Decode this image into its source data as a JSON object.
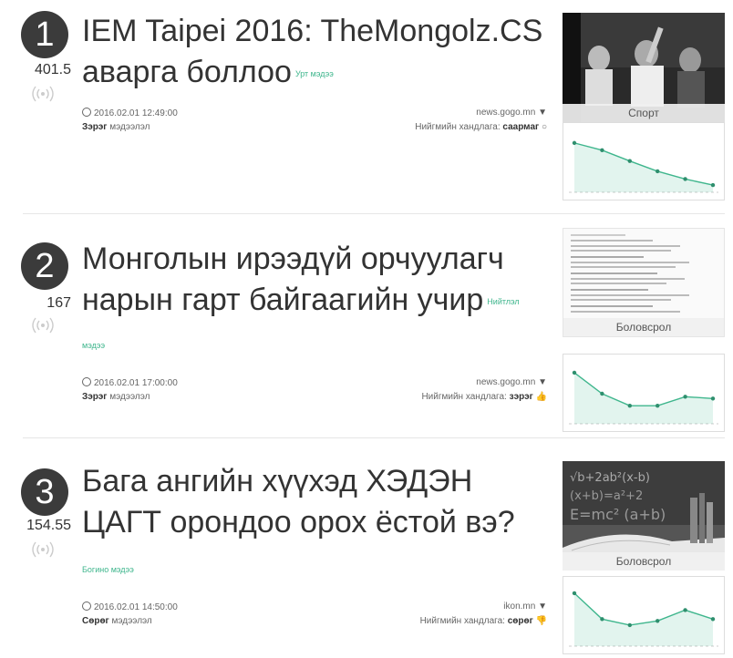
{
  "items": [
    {
      "rank": "1",
      "score": "401.5",
      "title_line1": "IEM Taipei 2016: TheMongolz.CS",
      "title_line2": "аварга боллоо",
      "tag": "Урт мэдээ",
      "date": "2016.02.01 12:49:00",
      "kind_bold": "Зэрэг",
      "kind_rest": " мэдээлэл",
      "source": "news.gogo.mn",
      "reaction_label": "Нийгмийн хандлага: ",
      "reaction_value": "саармаг",
      "category": "Спорт",
      "trend": [
        0.82,
        0.7,
        0.52,
        0.35,
        0.22,
        0.12
      ]
    },
    {
      "rank": "2",
      "score": "167",
      "title_line1": "Монголын ирээдүй орчуулагч",
      "title_line2": "нарын гарт байгаагийн учир",
      "tag": "Нийтлэл",
      "tag_cont": "мэдээ",
      "date": "2016.02.01 17:00:00",
      "kind_bold": "Зэрэг",
      "kind_rest": " мэдээлэл",
      "source": "news.gogo.mn",
      "reaction_label": "Нийгмийн хандлага: ",
      "reaction_value": "зэрэг",
      "category": "Боловсрол",
      "trend": [
        0.85,
        0.5,
        0.3,
        0.3,
        0.45,
        0.42
      ]
    },
    {
      "rank": "3",
      "score": "154.55",
      "title_line1": "Бага ангийн хүүхэд ХЭДЭН",
      "title_line2": "ЦАГТ орондоо орох ёстой вэ?",
      "tag": "Богино мэдээ",
      "date": "2016.02.01 14:50:00",
      "kind_bold": "Сөрөг",
      "kind_rest": " мэдээлэл",
      "source": "ikon.mn",
      "reaction_label": "Нийгмийн хандлага: ",
      "reaction_value": "сөрөг",
      "category": "Боловсрол",
      "trend": [
        0.88,
        0.45,
        0.35,
        0.42,
        0.6,
        0.45
      ]
    }
  ],
  "accent": "#3fb68d"
}
